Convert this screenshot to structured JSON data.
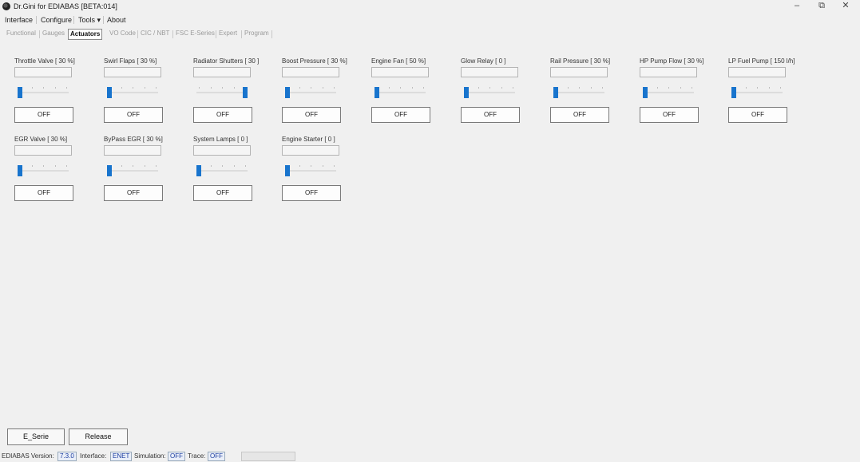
{
  "window": {
    "title": "Dr.Gini for EDIABAS [BETA:014]",
    "minimize": "–",
    "restore": "⧉",
    "close": "✕"
  },
  "menu": {
    "items": [
      "Interface",
      "Configure",
      "Tools ▾",
      "About"
    ]
  },
  "tabs": {
    "items": [
      "Functional",
      "Gauges",
      "Actuators",
      "VO Code",
      "CIC / NBT",
      "FSC E-Series",
      "Expert",
      "Program"
    ],
    "active": "Actuators"
  },
  "actuators": [
    {
      "label": "Throttle Valve [ 30 %]",
      "button": "OFF",
      "level": 0.0
    },
    {
      "label": "Swirl Flaps [ 30 %]",
      "button": "OFF",
      "level": 0.0
    },
    {
      "label": "Radiator Shutters [ 30 ]",
      "button": "OFF",
      "level": 1.0
    },
    {
      "label": "Boost Pressure [ 30 %]",
      "button": "OFF",
      "level": 0.0
    },
    {
      "label": "Engine Fan [ 50 %]",
      "button": "OFF",
      "level": 0.0
    },
    {
      "label": "Glow Relay [ 0 ]",
      "button": "OFF",
      "level": 0.0
    },
    {
      "label": "Rail Pressure [ 30 %]",
      "button": "OFF",
      "level": 0.0
    },
    {
      "label": "HP Pump Flow [ 30 %]",
      "button": "OFF",
      "level": 0.0
    },
    {
      "label": "LP Fuel Pump [ 150 l/h]",
      "button": "OFF",
      "level": 0.0
    },
    {
      "label": "EGR Valve [ 30 %]",
      "button": "OFF",
      "level": 0.0
    },
    {
      "label": "ByPass EGR [ 30 %]",
      "button": "OFF",
      "level": 0.0
    },
    {
      "label": "System Lamps [ 0 ]",
      "button": "OFF",
      "level": 0.0
    },
    {
      "label": "Engine Starter [ 0 ]",
      "button": "OFF",
      "level": 0.0
    }
  ],
  "bottom": {
    "eserie": "E_Serie",
    "release": "Release"
  },
  "status": {
    "version_label": "EDIABAS Version:",
    "version": "7.3.0",
    "interface_label": "Interface:",
    "interface": "ENET",
    "simulation_label": "Simulation:",
    "simulation": "OFF",
    "trace_label": "Trace:",
    "trace": "OFF"
  }
}
